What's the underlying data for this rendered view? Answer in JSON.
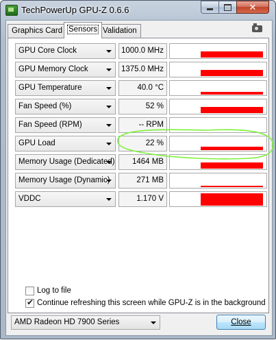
{
  "window": {
    "title": "TechPowerUp GPU-Z 0.6.6",
    "close_glyph": "✕"
  },
  "tabs": [
    {
      "label": "Graphics Card",
      "active": false
    },
    {
      "label": "Sensors",
      "active": true
    },
    {
      "label": "Validation",
      "active": false
    }
  ],
  "sensors": [
    {
      "name": "GPU Core Clock",
      "value": "1000.0 MHz",
      "graph_level": 0.45
    },
    {
      "name": "GPU Memory Clock",
      "value": "1375.0 MHz",
      "graph_level": 0.45
    },
    {
      "name": "GPU Temperature",
      "value": "40.0 °C",
      "graph_level": 0.18
    },
    {
      "name": "Fan Speed (%)",
      "value": "52 %",
      "graph_level": 0.45
    },
    {
      "name": "Fan Speed (RPM)",
      "value": "-- RPM",
      "graph_level": 0.0
    },
    {
      "name": "GPU Load",
      "value": "22 %",
      "graph_level": 0.22
    },
    {
      "name": "Memory Usage (Dedicated)",
      "value": "1464 MB",
      "graph_level": 0.45
    },
    {
      "name": "Memory Usage (Dynamic)",
      "value": "271 MB",
      "graph_level": 0.08
    },
    {
      "name": "VDDC",
      "value": "1.170 V",
      "graph_level": 0.85
    }
  ],
  "options": {
    "log_to_file": {
      "label": "Log to file",
      "checked": false
    },
    "continue_refresh": {
      "label": "Continue refreshing this screen while GPU-Z is in the background",
      "checked": true
    }
  },
  "footer": {
    "gpu_selected": "AMD Radeon HD 7900 Series",
    "close_label": "Close"
  },
  "colors": {
    "graph_bar": "#ff0000",
    "annotation": "#7cf23a"
  },
  "icons": {
    "app": "gpuz-chip-icon",
    "screenshot": "camera-icon"
  }
}
